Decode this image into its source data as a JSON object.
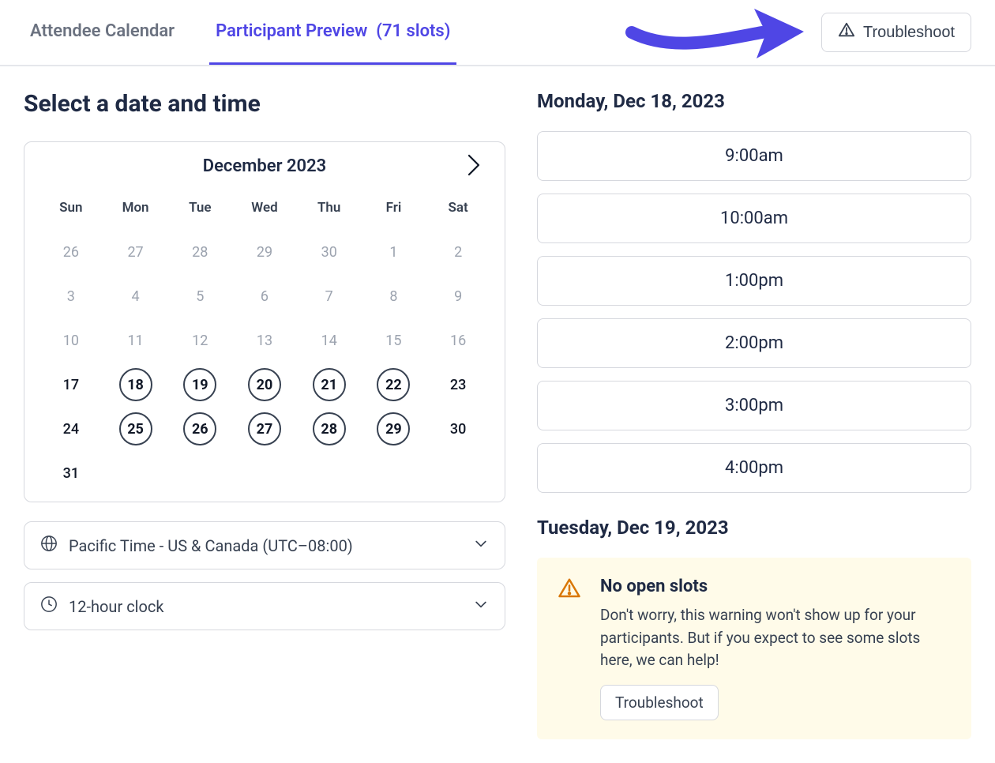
{
  "tabs": {
    "attendee": "Attendee Calendar",
    "participant_prefix": "Participant Preview",
    "slots_suffix": "(71 slots)"
  },
  "troubleshoot_label": "Troubleshoot",
  "page_title": "Select a date and time",
  "calendar": {
    "month_label": "December 2023",
    "dow": [
      "Sun",
      "Mon",
      "Tue",
      "Wed",
      "Thu",
      "Fri",
      "Sat"
    ],
    "weeks": [
      [
        {
          "n": "26",
          "state": "muted"
        },
        {
          "n": "27",
          "state": "muted"
        },
        {
          "n": "28",
          "state": "muted"
        },
        {
          "n": "29",
          "state": "muted"
        },
        {
          "n": "30",
          "state": "muted"
        },
        {
          "n": "1",
          "state": "muted"
        },
        {
          "n": "2",
          "state": "muted"
        }
      ],
      [
        {
          "n": "3",
          "state": "muted"
        },
        {
          "n": "4",
          "state": "muted"
        },
        {
          "n": "5",
          "state": "muted"
        },
        {
          "n": "6",
          "state": "muted"
        },
        {
          "n": "7",
          "state": "muted"
        },
        {
          "n": "8",
          "state": "muted"
        },
        {
          "n": "9",
          "state": "muted"
        }
      ],
      [
        {
          "n": "10",
          "state": "muted"
        },
        {
          "n": "11",
          "state": "muted"
        },
        {
          "n": "12",
          "state": "muted"
        },
        {
          "n": "13",
          "state": "muted"
        },
        {
          "n": "14",
          "state": "muted"
        },
        {
          "n": "15",
          "state": "muted"
        },
        {
          "n": "16",
          "state": "muted"
        }
      ],
      [
        {
          "n": "17",
          "state": "normal"
        },
        {
          "n": "18",
          "state": "available"
        },
        {
          "n": "19",
          "state": "available"
        },
        {
          "n": "20",
          "state": "available"
        },
        {
          "n": "21",
          "state": "available"
        },
        {
          "n": "22",
          "state": "available"
        },
        {
          "n": "23",
          "state": "normal"
        }
      ],
      [
        {
          "n": "24",
          "state": "normal"
        },
        {
          "n": "25",
          "state": "available"
        },
        {
          "n": "26",
          "state": "available"
        },
        {
          "n": "27",
          "state": "available"
        },
        {
          "n": "28",
          "state": "available"
        },
        {
          "n": "29",
          "state": "available"
        },
        {
          "n": "30",
          "state": "normal"
        }
      ],
      [
        {
          "n": "31",
          "state": "normal"
        },
        {
          "n": "",
          "state": "empty"
        },
        {
          "n": "",
          "state": "empty"
        },
        {
          "n": "",
          "state": "empty"
        },
        {
          "n": "",
          "state": "empty"
        },
        {
          "n": "",
          "state": "empty"
        },
        {
          "n": "",
          "state": "empty"
        }
      ]
    ]
  },
  "timezone_label": "Pacific Time - US & Canada (UTC–08:00)",
  "clock_label": "12-hour clock",
  "days": [
    {
      "heading": "Monday, Dec 18, 2023",
      "slots": [
        "9:00am",
        "10:00am",
        "1:00pm",
        "2:00pm",
        "3:00pm",
        "4:00pm"
      ]
    },
    {
      "heading": "Tuesday, Dec 19, 2023",
      "slots": []
    }
  ],
  "warning": {
    "title": "No open slots",
    "body": "Don't worry, this warning won't show up for your participants. But if you expect to see some slots here, we can help!",
    "button": "Troubleshoot"
  }
}
